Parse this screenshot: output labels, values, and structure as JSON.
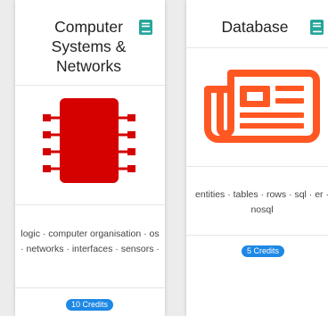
{
  "cards": [
    {
      "title": "Computer Systems & Networks",
      "icon": "book-icon",
      "illustration": "cpu-chip-icon",
      "tags": "logic · computer organisation · os · networks · interfaces · sensors ·",
      "credits": "10 Credits"
    },
    {
      "title": "Database",
      "icon": "book-icon",
      "illustration": "newspaper-icon",
      "tags": "entities · tables · rows · sql · er · nosql",
      "credits": "5 Credits"
    }
  ],
  "colors": {
    "background": "#ececec",
    "card": "#ffffff",
    "book_icon": "#26a69a",
    "chip": "#d50000",
    "newspaper": "#ff5722",
    "badge": "#1e88e5"
  }
}
